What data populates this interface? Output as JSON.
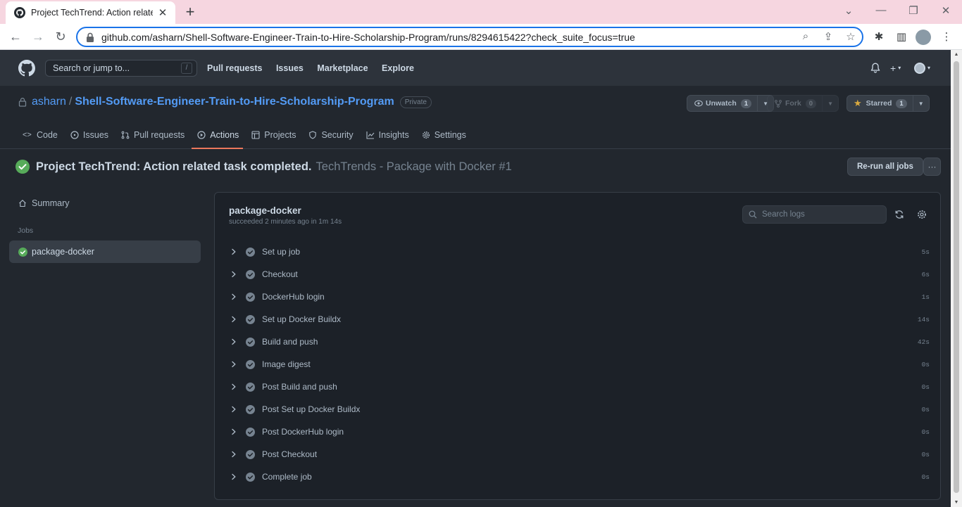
{
  "browser": {
    "tab_title": "Project TechTrend: Action related",
    "url": "github.com/asharn/Shell-Software-Engineer-Train-to-Hire-Scholarship-Program/runs/8294615422?check_suite_focus=true"
  },
  "gh": {
    "search_placeholder": "Search or jump to...",
    "search_shortcut": "/",
    "nav": [
      "Pull requests",
      "Issues",
      "Marketplace",
      "Explore"
    ]
  },
  "repo": {
    "owner": "asharn",
    "separator": "/",
    "name": "Shell-Software-Engineer-Train-to-Hire-Scholarship-Program",
    "visibility": "Private",
    "watch_label": "Unwatch",
    "watch_count": "1",
    "fork_label": "Fork",
    "fork_count": "0",
    "star_label": "Starred",
    "star_count": "1",
    "tabs": [
      "Code",
      "Issues",
      "Pull requests",
      "Actions",
      "Projects",
      "Security",
      "Insights",
      "Settings"
    ]
  },
  "run": {
    "title": "Project TechTrend: Action related task completed.",
    "workflow": "TechTrends - Package with Docker #1",
    "rerun_label": "Re-run all jobs",
    "more_label": "···"
  },
  "sidebar": {
    "summary": "Summary",
    "jobs_label": "Jobs",
    "job": "package-docker"
  },
  "job": {
    "name": "package-docker",
    "status": "succeeded 2 minutes ago in 1m 14s",
    "search_placeholder": "Search logs",
    "steps": [
      {
        "name": "Set up job",
        "duration": "5s"
      },
      {
        "name": "Checkout",
        "duration": "6s"
      },
      {
        "name": "DockerHub login",
        "duration": "1s"
      },
      {
        "name": "Set up Docker Buildx",
        "duration": "14s"
      },
      {
        "name": "Build and push",
        "duration": "42s"
      },
      {
        "name": "Image digest",
        "duration": "0s"
      },
      {
        "name": "Post Build and push",
        "duration": "0s"
      },
      {
        "name": "Post Set up Docker Buildx",
        "duration": "0s"
      },
      {
        "name": "Post DockerHub login",
        "duration": "0s"
      },
      {
        "name": "Post Checkout",
        "duration": "0s"
      },
      {
        "name": "Complete job",
        "duration": "0s"
      }
    ]
  },
  "colors": {
    "success": "#57ab5a",
    "accent_link": "#539bf5",
    "tab_underline": "#ec775c",
    "star": "#daaa3f"
  }
}
